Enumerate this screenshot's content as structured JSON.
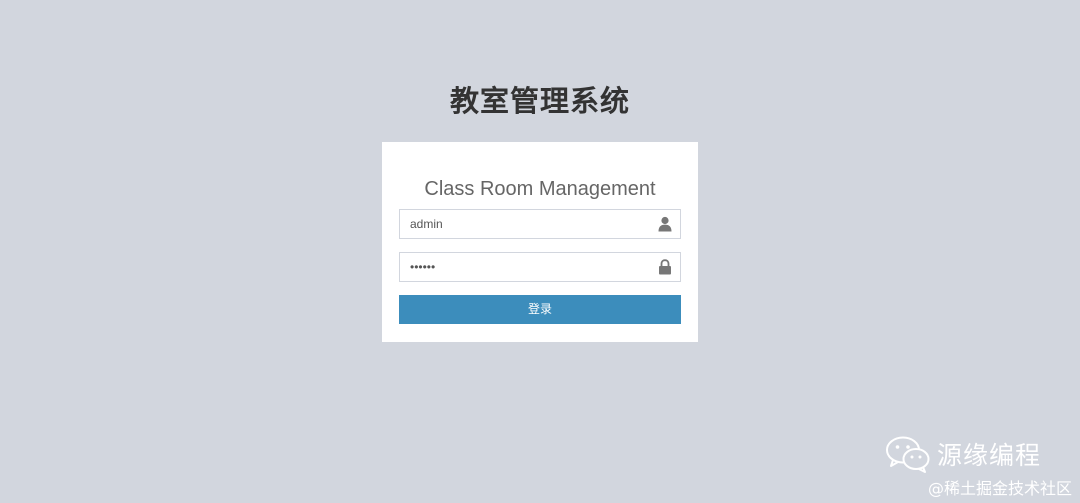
{
  "page": {
    "title": "教室管理系统"
  },
  "login": {
    "heading": "Class Room Management",
    "username_value": "admin",
    "password_value": "123456",
    "submit_label": "登录"
  },
  "watermark": {
    "brand": "源缘编程",
    "site": "@稀土掘金技术社区"
  },
  "icons": {
    "username": "user-icon",
    "password": "lock-icon",
    "brand": "wechat-icon"
  },
  "colors": {
    "background": "#d2d6de",
    "primary_button": "#3c8dbc",
    "card": "#ffffff"
  }
}
